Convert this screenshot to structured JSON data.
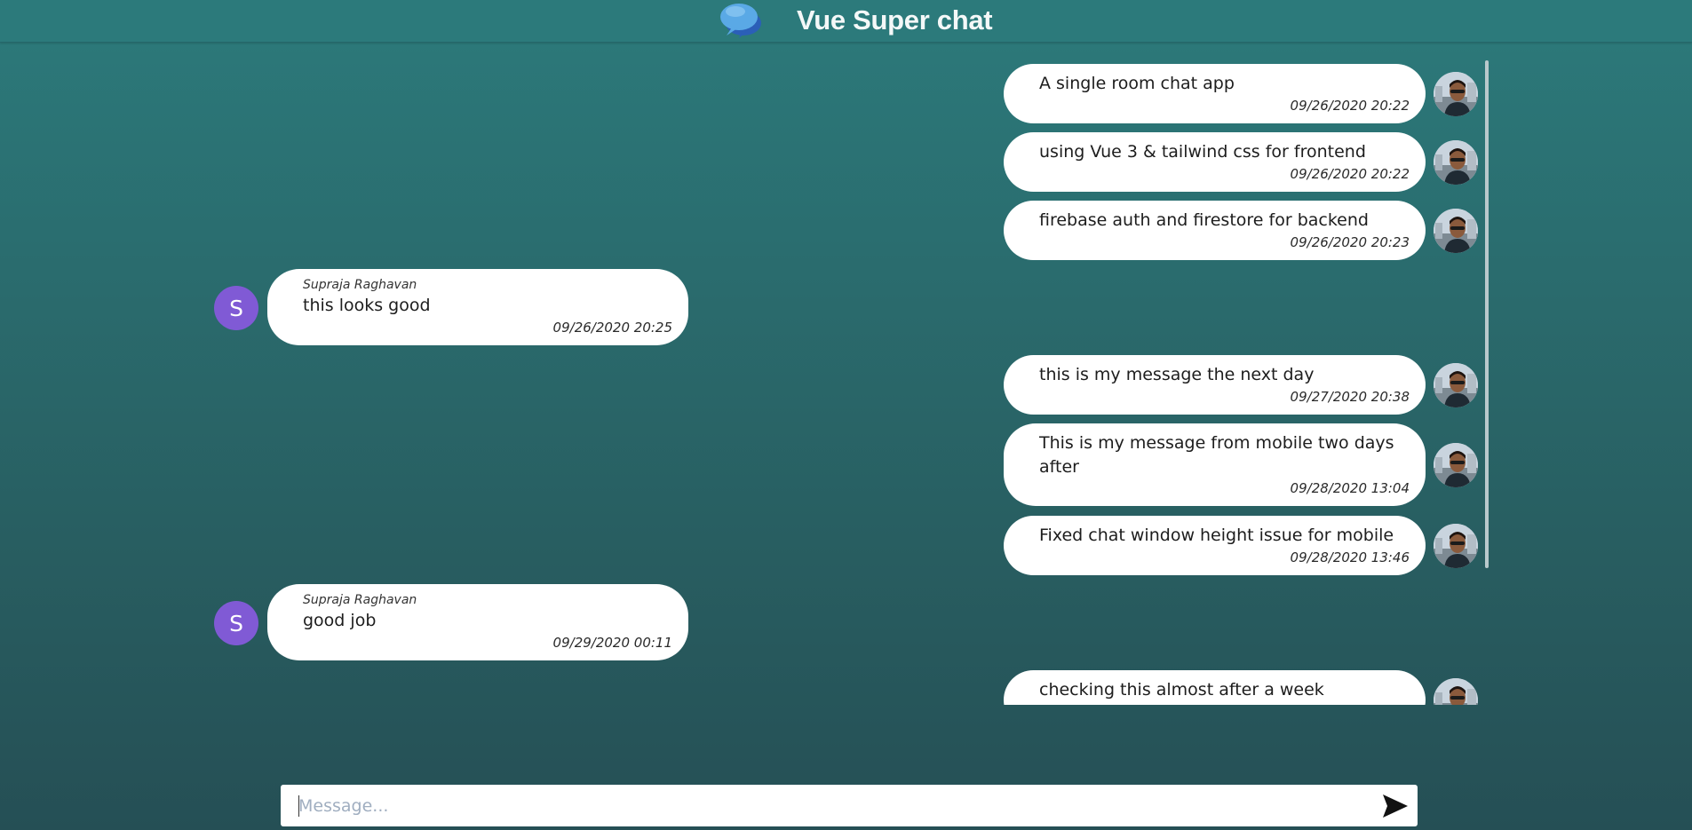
{
  "header": {
    "title": "Vue Super chat",
    "logo_icon": "speech-bubbles-icon"
  },
  "messages": [
    {
      "side": "right",
      "text": "A single room chat app",
      "time": "09/26/2020 20:22",
      "avatar": "user-photo"
    },
    {
      "side": "right",
      "text": "using Vue 3 & tailwind css for frontend",
      "time": "09/26/2020 20:22",
      "avatar": "user-photo"
    },
    {
      "side": "right",
      "text": "firebase auth and firestore for backend",
      "time": "09/26/2020 20:23",
      "avatar": "user-photo"
    },
    {
      "side": "left",
      "sender": "Supraja Raghavan",
      "initial": "S",
      "text": "this looks good",
      "time": "09/26/2020 20:25"
    },
    {
      "side": "right",
      "text": "this is my message the next day",
      "time": "09/27/2020 20:38",
      "avatar": "user-photo"
    },
    {
      "side": "right",
      "text": "This is my message from mobile two days after",
      "time": "09/28/2020 13:04",
      "avatar": "user-photo"
    },
    {
      "side": "right",
      "text": "Fixed chat window height issue for mobile",
      "time": "09/28/2020 13:46",
      "avatar": "user-photo"
    },
    {
      "side": "left",
      "sender": "Supraja Raghavan",
      "initial": "S",
      "text": "good job",
      "time": "09/29/2020 00:11"
    },
    {
      "side": "right",
      "text": "checking this almost after a week",
      "time": "",
      "avatar": "user-photo"
    }
  ],
  "composer": {
    "placeholder": "Message...",
    "value": "",
    "send_icon": "send-arrow-icon"
  },
  "colors": {
    "header": "#2c7a7b",
    "background_top": "#2c7a7b",
    "background_bottom": "#254f55",
    "bubble": "#ffffff",
    "avatar_initial_bg": "#805ad5"
  }
}
